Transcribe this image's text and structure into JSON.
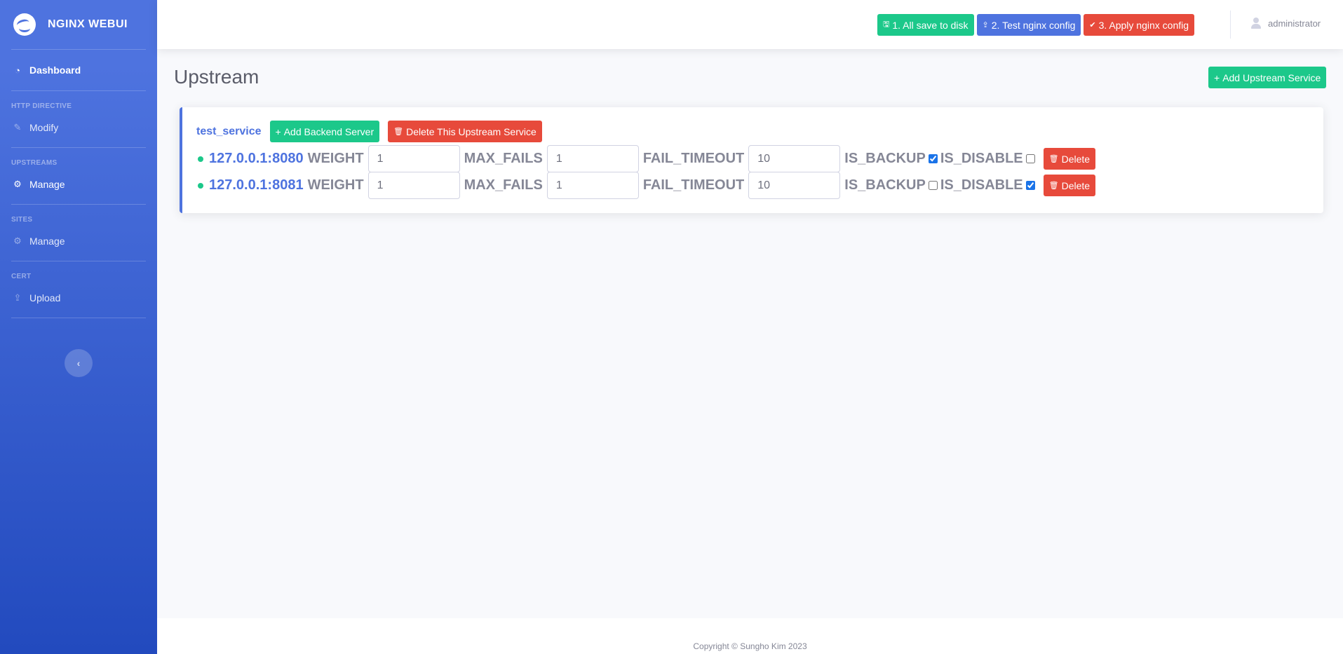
{
  "brand": {
    "name": "NGINX WEBUI"
  },
  "sidebar": {
    "dashboard_label": "Dashboard",
    "sections": [
      {
        "heading": "HTTP DIRECTIVE",
        "item": "Modify"
      },
      {
        "heading": "UPSTREAMS",
        "item": "Manage"
      },
      {
        "heading": "SITES",
        "item": "Manage"
      },
      {
        "heading": "CERT",
        "item": "Upload"
      }
    ]
  },
  "topbar": {
    "save_label": "1. All save to disk",
    "test_label": "2. Test nginx config",
    "apply_label": "3. Apply nginx config",
    "user_name": "administrator"
  },
  "page": {
    "title": "Upstream",
    "add_upstream_label": "Add Upstream Service"
  },
  "upstream": {
    "name": "test_service",
    "add_backend_label": "Add Backend Server",
    "delete_upstream_label": "Delete This Upstream Service",
    "field_labels": {
      "weight": "WEIGHT",
      "max_fails": "MAX_FAILS",
      "fail_timeout": "FAIL_TIMEOUT",
      "is_backup": "IS_BACKUP",
      "is_disable": "IS_DISABLE",
      "delete": "Delete"
    },
    "servers": [
      {
        "address": "127.0.0.1:8080",
        "weight": "1",
        "max_fails": "1",
        "fail_timeout": "10",
        "is_backup": true,
        "is_disable": false
      },
      {
        "address": "127.0.0.1:8081",
        "weight": "1",
        "max_fails": "1",
        "fail_timeout": "10",
        "is_backup": false,
        "is_disable": true
      }
    ]
  },
  "footer": {
    "copyright": "Copyright © Sungho Kim 2023"
  },
  "colors": {
    "primary": "#4e73df",
    "success": "#1cc88a",
    "danger": "#e74a3b"
  }
}
